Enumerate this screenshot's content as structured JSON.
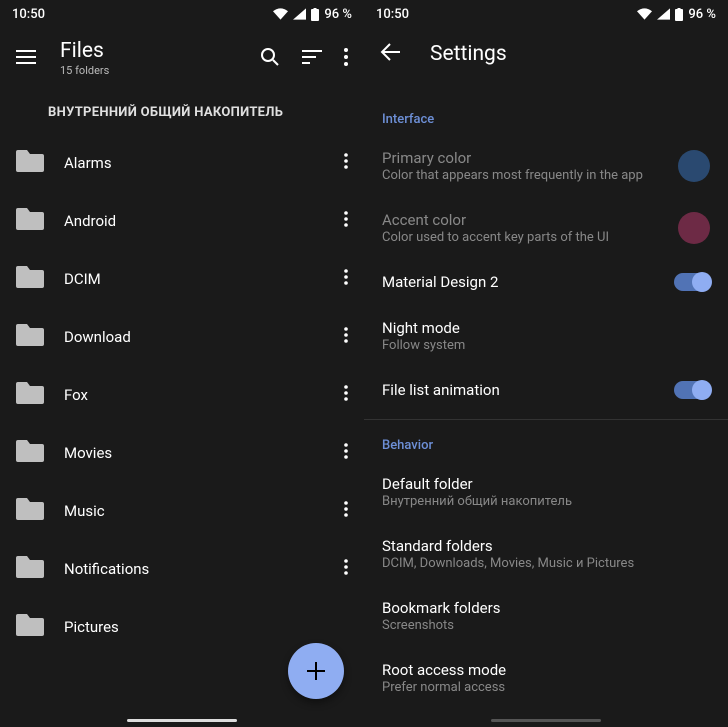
{
  "status": {
    "time": "10:50",
    "battery": "96 %"
  },
  "files_screen": {
    "title": "Files",
    "subtitle": "15 folders",
    "section_header": "ВНУТРЕННИЙ ОБЩИЙ НАКОПИТЕЛЬ",
    "folders": [
      {
        "name": "Alarms"
      },
      {
        "name": "Android"
      },
      {
        "name": "DCIM"
      },
      {
        "name": "Download"
      },
      {
        "name": "Fox"
      },
      {
        "name": "Movies"
      },
      {
        "name": "Music"
      },
      {
        "name": "Notifications"
      },
      {
        "name": "Pictures"
      }
    ]
  },
  "settings_screen": {
    "title": "Settings",
    "sections": [
      {
        "category": "Interface",
        "items": [
          {
            "title": "Primary color",
            "subtitle": "Color that appears most frequently in the app",
            "type": "color",
            "color": "#2a4970",
            "dimmed": true
          },
          {
            "title": "Accent color",
            "subtitle": "Color used to accent key parts of the UI",
            "type": "color",
            "color": "#6d2a45",
            "dimmed": true
          },
          {
            "title": "Material Design 2",
            "type": "switch",
            "on": true
          },
          {
            "title": "Night mode",
            "subtitle": "Follow system",
            "type": "link"
          },
          {
            "title": "File list animation",
            "type": "switch",
            "on": true
          }
        ]
      },
      {
        "category": "Behavior",
        "items": [
          {
            "title": "Default folder",
            "subtitle": "Внутренний общий накопитель",
            "type": "link"
          },
          {
            "title": "Standard folders",
            "subtitle": "DCIM, Downloads, Movies, Music и Pictures",
            "type": "link"
          },
          {
            "title": "Bookmark folders",
            "subtitle": "Screenshots",
            "type": "link"
          },
          {
            "title": "Root access mode",
            "subtitle": "Prefer normal access",
            "type": "link"
          }
        ]
      }
    ]
  }
}
